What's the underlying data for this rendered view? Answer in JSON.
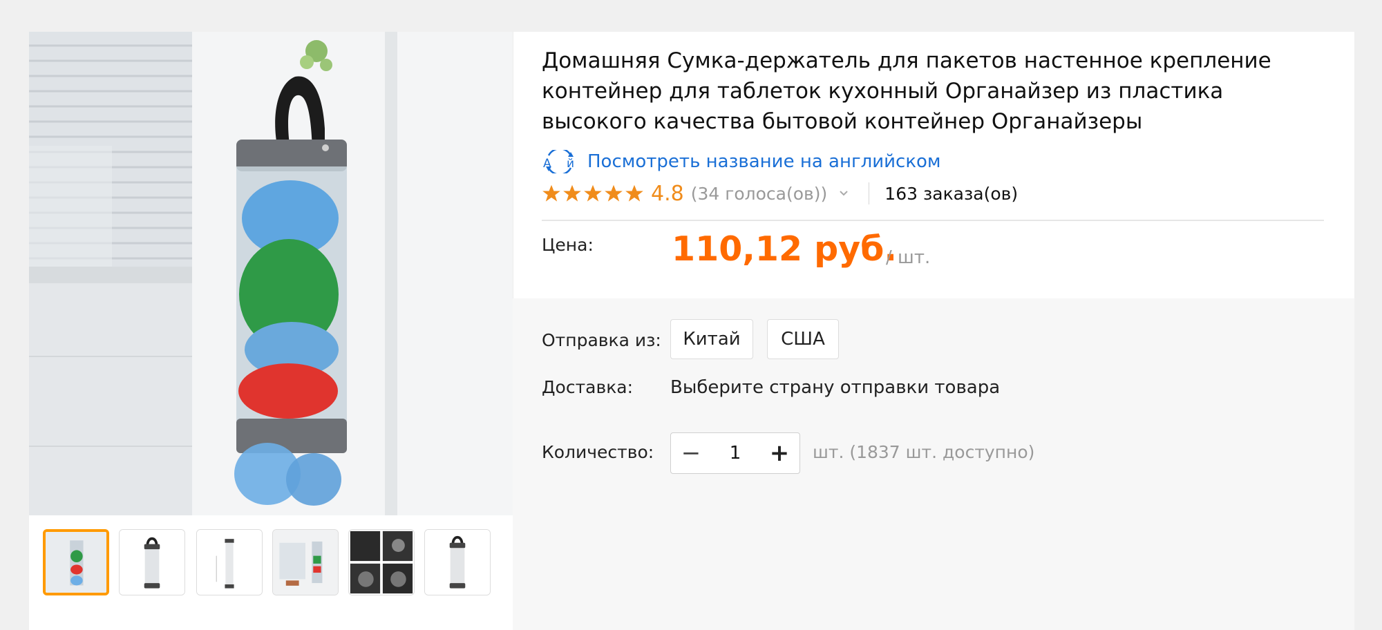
{
  "product": {
    "title": "Домашняя Сумка-держатель для пакетов настенное крепление контейнер для таблеток кухонный Органайзер из пластика высокого качества бытовой контейнер Органайзеры",
    "translate_icon": "translate-icon",
    "translate_link": "Посмотреть название на английском",
    "rating": {
      "stars": 5,
      "value": "4.8",
      "votes": "(34 голоса(ов))",
      "orders": "163 заказа(ов)"
    },
    "price": {
      "label": "Цена:",
      "value": "110,12 руб.",
      "unit": "/ шт."
    }
  },
  "gallery": {
    "thumbnails": 6,
    "active_index": 0,
    "active_border_color": "#ff9a00"
  },
  "options": {
    "shipping_from": {
      "label": "Отправка из:",
      "choices": [
        "Китай",
        "США"
      ]
    },
    "delivery": {
      "label": "Доставка:",
      "text": "Выберите страну отправки товара"
    },
    "quantity": {
      "label": "Количество:",
      "value": "1",
      "minus": "−",
      "plus": "+",
      "available": "шт. (1837 шт. доступно)"
    }
  },
  "colors": {
    "price": "#ff6a00",
    "rating": "#f08c1b",
    "link": "#1a6fd6"
  }
}
